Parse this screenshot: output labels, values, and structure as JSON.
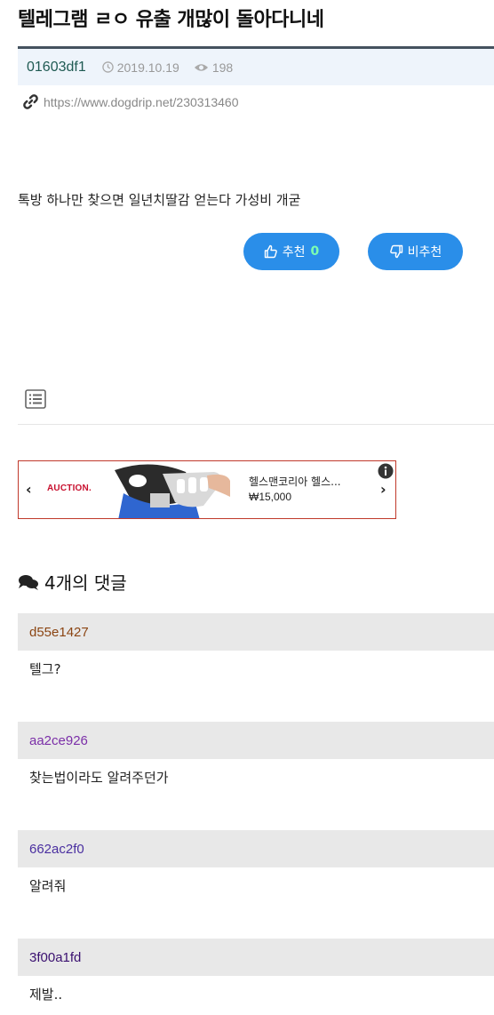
{
  "post": {
    "title": "텔레그램 ㄹㅇ 유출 개많이 돌아다니네",
    "author": "01603df1",
    "date": "2019.10.19",
    "views": "198",
    "url": "https://www.dogdrip.net/230313460",
    "body": "톡방 하나만 찾으면 일년치딸감 얻는다 가성비 개굳"
  },
  "votes": {
    "up_label": "추천",
    "up_count": "0",
    "down_label": "비추천"
  },
  "ad": {
    "logo": "AUCTION.",
    "product_name": "헬스맨코리아 헬스...",
    "price": "₩15,000"
  },
  "comments": {
    "header": "4개의 댓글",
    "items": [
      {
        "author": "d55e1427",
        "text": "텔그?",
        "color": "#8b4513"
      },
      {
        "author": "aa2ce926",
        "text": "찾는법이라도 알려주던가",
        "color": "#7b2fa8"
      },
      {
        "author": "662ac2f0",
        "text": "알려줘",
        "color": "#4a2fa0"
      },
      {
        "author": "3f00a1fd",
        "text": "제발..",
        "color": "#3a1070"
      }
    ]
  },
  "colors": {
    "accent": "#2a8ee9",
    "meta_bar_bg": "#eef4fb",
    "author": "#1f5a52"
  },
  "icons": [
    "clock-icon",
    "eye-icon",
    "link-icon",
    "thumbs-up-icon",
    "thumbs-down-icon",
    "list-icon",
    "info-icon",
    "comments-icon"
  ]
}
